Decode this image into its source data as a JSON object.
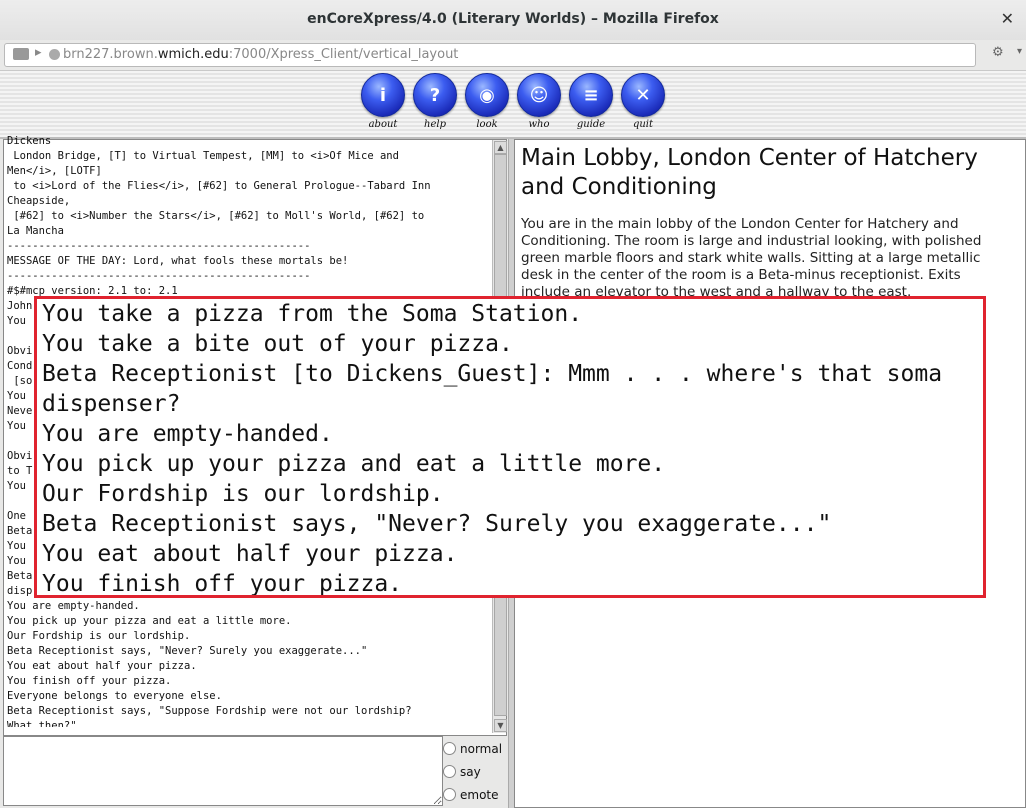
{
  "window": {
    "title": "enCoreXpress/4.0 (Literary Worlds) – Mozilla Firefox",
    "close_glyph": "✕"
  },
  "urlbar": {
    "url_prefix": "brn227.brown.",
    "url_domain": "wmich.edu",
    "url_suffix": ":7000/Xpress_Client/vertical_layout"
  },
  "toolbar": {
    "buttons": [
      {
        "label": "about",
        "icon": "info-icon",
        "glyph": "i"
      },
      {
        "label": "help",
        "icon": "help-bulb-icon",
        "glyph": "?"
      },
      {
        "label": "look",
        "icon": "eye-icon",
        "glyph": "◉"
      },
      {
        "label": "who",
        "icon": "person-icon",
        "glyph": "☺"
      },
      {
        "label": "guide",
        "icon": "book-icon",
        "glyph": "≡"
      },
      {
        "label": "quit",
        "icon": "close-icon",
        "glyph": "✕"
      }
    ]
  },
  "log_lines": [
    "Dickens",
    " London Bridge, [T] to Virtual Tempest, [MM] to <i>Of Mice and",
    "Men</i>, [LOTF]",
    " to <i>Lord of the Flies</i>, [#62] to General Prologue--Tabard Inn",
    "Cheapside,",
    " [#62] to <i>Number the Stars</i>, [#62] to Moll's World, [#62] to",
    "La Mancha",
    "------------------------------------------------",
    "MESSAGE OF THE DAY: Lord, what fools these mortals be!",
    "------------------------------------------------",
    "#$#mcp version: 2.1 to: 2.1",
    "John",
    "You",
    "",
    "Obvi",
    "Cond",
    " [so",
    "You",
    "Neve",
    "You",
    "",
    "Obvi",
    "to T",
    "You",
    "",
    "One",
    "Beta",
    "You",
    "You",
    "Beta",
    "disp",
    "You are empty-handed.",
    "You pick up your pizza and eat a little more.",
    "Our Fordship is our lordship.",
    "Beta Receptionist says, \"Never? Surely you exaggerate...\"",
    "You eat about half your pizza.",
    "You finish off your pizza.",
    "Everyone belongs to everyone else.",
    "Beta Receptionist says, \"Suppose Fordship were not our lordship?",
    "What then?\""
  ],
  "input": {
    "value": "",
    "modes": [
      "normal",
      "say",
      "emote"
    ]
  },
  "room": {
    "title": "Main Lobby, London Center of Hatchery and Conditioning",
    "description": "You are in the main lobby of the London Center for Hatchery and Conditioning. The room is large and industrial looking, with polished green marble floors and stark white walls. Sitting at a large metallic desk in the center of the room is a Beta-minus receptionist. Exits include an elevator to the west and a hallway to the east."
  },
  "zoom_lines": [
    "You take a pizza from the Soma Station.",
    "You take a bite out of your pizza.",
    "Beta Receptionist [to Dickens_Guest]: Mmm . . . where's that soma",
    "dispenser?",
    "You are empty-handed.",
    "You pick up your pizza and eat a little more.",
    "Our Fordship is our lordship.",
    "Beta Receptionist says, \"Never? Surely you exaggerate...\"",
    "You eat about half your pizza.",
    "You finish off your pizza."
  ],
  "colors": {
    "highlight_border": "#e0232f",
    "toolbar_button": "#2a44d8"
  }
}
